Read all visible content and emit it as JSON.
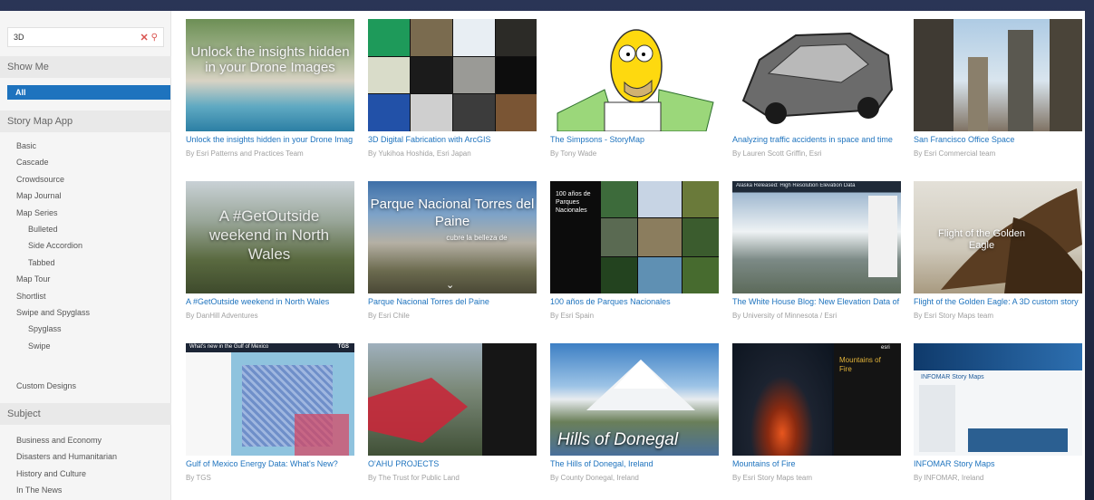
{
  "search": {
    "value": "3D"
  },
  "sidebar": {
    "show_me": "Show Me",
    "all": "All",
    "story_map_app": "Story Map App",
    "apps": [
      "Basic",
      "Cascade",
      "Crowdsource",
      "Map Journal",
      "Map Series",
      "Bulleted",
      "Side Accordion",
      "Tabbed",
      "Map Tour",
      "Shortlist",
      "Swipe and Spyglass",
      "Spyglass",
      "Swipe"
    ],
    "custom_designs": "Custom Designs",
    "subject": "Subject",
    "subjects": [
      "Business and Economy",
      "Disasters and Humanitarian",
      "History and Culture",
      "In The News"
    ]
  },
  "cards": [
    {
      "title": "Unlock the insights hidden in your Drone Imag",
      "author": "By Esri Patterns and Practices Team",
      "overlay": "Unlock the insights hidden in your Drone Images"
    },
    {
      "title": "3D Digital Fabrication with ArcGIS",
      "author": "By Yukihoa Hoshida, Esri Japan"
    },
    {
      "title": "The Simpsons - StoryMap",
      "author": "By Tony Wade"
    },
    {
      "title": "Analyzing traffic accidents in space and time",
      "author": "By Lauren Scott Griffin, Esri"
    },
    {
      "title": "San Francisco Office Space",
      "author": "By Esri Commercial team"
    },
    {
      "title": "A #GetOutside weekend in North Wales",
      "author": "By DanHill Adventures",
      "overlay": "A #GetOutside weekend in North Wales"
    },
    {
      "title": "Parque Nacional Torres del Paine",
      "author": "By Esri Chile",
      "overlay": "Parque Nacional Torres del Paine",
      "overlay_sub": "cubre la belleza de"
    },
    {
      "title": "100 años de Parques Nacionales",
      "author": "By Esri Spain",
      "overlay": "100 años de Parques Nacionales"
    },
    {
      "title": "The White House Blog: New Elevation Data of",
      "author": "By University of Minnesota / Esri",
      "overlay": "Alaska Released: High Resolution Elevation Data"
    },
    {
      "title": "Flight of the Golden Eagle: A 3D custom story",
      "author": "By Esri Story Maps team",
      "overlay": "Flight of the Golden Eagle"
    },
    {
      "title": "Gulf of Mexico Energy Data: What's New?",
      "author": "By TGS",
      "overlay": "What's new in the Gulf of Mexico",
      "overlay_sub": "TGS"
    },
    {
      "title": "O'AHU PROJECTS",
      "author": "By The Trust for Public Land"
    },
    {
      "title": "The Hills of Donegal, Ireland",
      "author": "By County Donegal, Ireland",
      "overlay": "Hills of Donegal"
    },
    {
      "title": "Mountains of Fire",
      "author": "By Esri Story Maps team",
      "overlay": "Mountains of Fire",
      "overlay_sub": "esri"
    },
    {
      "title": "INFOMAR Story Maps",
      "author": "By INFOMAR, Ireland",
      "overlay": "INFOMAR Story Maps"
    }
  ],
  "colors": {
    "accent": "#1e73be",
    "frame": "#1f2740",
    "clear": "#d9534f"
  }
}
